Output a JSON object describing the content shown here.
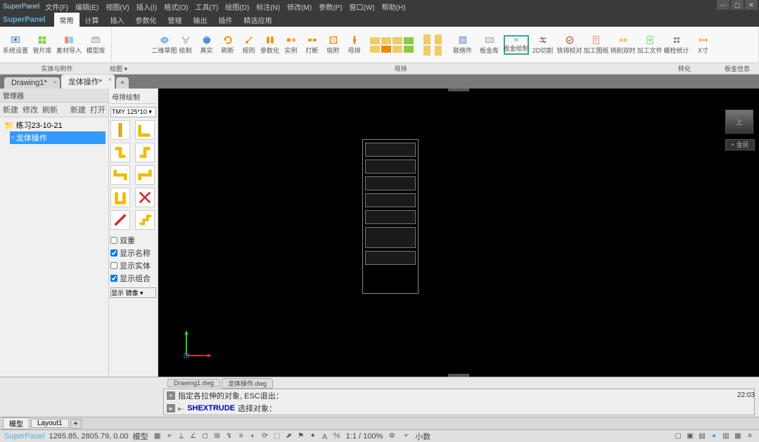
{
  "app": {
    "title": "SuperPanel"
  },
  "menubar": [
    "文件(F)",
    "编辑(E)",
    "视图(V)",
    "插入(I)",
    "格式(O)",
    "工具(T)",
    "绘图(D)",
    "标注(N)",
    "修改(M)",
    "参数(P)",
    "窗口(W)",
    "帮助(H)"
  ],
  "ribbon_tabs": [
    "常用",
    "计算",
    "插入",
    "参数化",
    "管理",
    "输出",
    "插件",
    "精选应用"
  ],
  "ribbon": {
    "g1": {
      "items": [
        "系统设置",
        "管片库",
        "素材导入",
        "模型库"
      ],
      "label": "实体与附件"
    },
    "g2": {
      "items": [
        "二维草图",
        "绘制",
        "真实",
        "刷新",
        "规则",
        "参数化",
        "实例",
        "打断",
        "吸附",
        "母排"
      ],
      "label": "绘图 ▾"
    },
    "g3": {
      "items": [
        "联络件",
        "板金库",
        "板金绘制"
      ],
      "label": ""
    },
    "g4": {
      "items": [
        "2D切割",
        "铁排校对",
        "加工图纸",
        "铣削双时"
      ],
      "label": ""
    },
    "g5": {
      "items": [
        "加工文件",
        "螺栓统计"
      ],
      "label": "转化"
    },
    "g6": {
      "items": [
        "X寸"
      ],
      "label": "板金信息"
    },
    "big_label": "母排"
  },
  "doc_tabs": [
    {
      "label": "Drawing1*",
      "active": false
    },
    {
      "label": "龙体操作*",
      "active": true
    }
  ],
  "left": {
    "header": "管理器",
    "toolbar": [
      "新建",
      "修改",
      "刷新"
    ],
    "toolbar_right": [
      "新建",
      "打开"
    ],
    "tree": [
      {
        "label": "练习23-10-21",
        "icon": "folder",
        "selected": false
      },
      {
        "label": "龙体操作",
        "icon": "box",
        "selected": true
      }
    ]
  },
  "bus": {
    "header": "母排绘制",
    "select": "TMY 125*10 ▾",
    "checks": [
      {
        "label": "双重",
        "checked": false
      },
      {
        "label": "显示名称",
        "checked": true
      },
      {
        "label": "显示实体",
        "checked": false
      },
      {
        "label": "显示组合",
        "checked": true
      }
    ],
    "display": "显示 镜像 ▾"
  },
  "canvas": {
    "nav_btn": "+ 金民",
    "cube": "上"
  },
  "model_tabs": [
    "Drawing1.dwg",
    "龙体操作.dwg"
  ],
  "cmd": {
    "line1": "指定各拉伸的对象, ESC退出：",
    "prompt": "SHEXTRUDE",
    "line2": "选择对象："
  },
  "layout_tabs": [
    "模型",
    "Layout1"
  ],
  "status": {
    "app": "SuperPanel",
    "coords": "1265.85, 2805.79, 0.00",
    "mode": "模型",
    "zoom": "1:1 / 100%",
    "param": "小数",
    "clock": "22:03"
  }
}
